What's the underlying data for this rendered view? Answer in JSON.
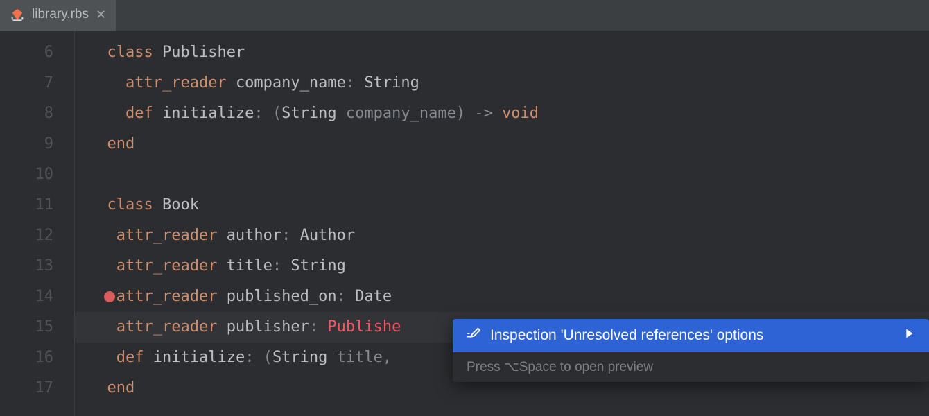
{
  "tab": {
    "filename": "library.rbs"
  },
  "gutter": {
    "start": 6,
    "end": 17
  },
  "code": {
    "lines": [
      {
        "indent": 1,
        "seg": [
          {
            "c": "kw",
            "t": "class "
          },
          {
            "c": "ident",
            "t": "Publisher"
          }
        ]
      },
      {
        "indent": 2,
        "seg": [
          {
            "c": "kw",
            "t": "attr_reader "
          },
          {
            "c": "ident",
            "t": "company_name"
          },
          {
            "c": "gray",
            "t": ": "
          },
          {
            "c": "type",
            "t": "String"
          }
        ]
      },
      {
        "indent": 2,
        "seg": [
          {
            "c": "kw",
            "t": "def "
          },
          {
            "c": "ident",
            "t": "initialize"
          },
          {
            "c": "gray",
            "t": ": ("
          },
          {
            "c": "type",
            "t": "String "
          },
          {
            "c": "gray",
            "t": "company_name) -> "
          },
          {
            "c": "kw",
            "t": "void"
          }
        ]
      },
      {
        "indent": 1,
        "seg": [
          {
            "c": "kw",
            "t": "end"
          }
        ]
      },
      {
        "indent": 0,
        "seg": []
      },
      {
        "indent": 1,
        "seg": [
          {
            "c": "kw",
            "t": "class "
          },
          {
            "c": "ident",
            "t": "Book"
          }
        ]
      },
      {
        "indent": 1,
        "seg": [
          {
            "c": "kw",
            "t": " attr_reader "
          },
          {
            "c": "ident",
            "t": "author"
          },
          {
            "c": "gray",
            "t": ": "
          },
          {
            "c": "type",
            "t": "Author"
          }
        ]
      },
      {
        "indent": 1,
        "seg": [
          {
            "c": "kw",
            "t": " attr_reader "
          },
          {
            "c": "ident",
            "t": "title"
          },
          {
            "c": "gray",
            "t": ": "
          },
          {
            "c": "type",
            "t": "String"
          }
        ]
      },
      {
        "indent": 1,
        "bulb": true,
        "seg": [
          {
            "c": "kw",
            "t": " attr_reader "
          },
          {
            "c": "ident",
            "t": "published_on"
          },
          {
            "c": "gray",
            "t": ": "
          },
          {
            "c": "type",
            "t": "Date"
          }
        ]
      },
      {
        "indent": 1,
        "hl": true,
        "seg": [
          {
            "c": "kw",
            "t": " attr_reader "
          },
          {
            "c": "ident",
            "t": "publisher"
          },
          {
            "c": "gray",
            "t": ": "
          },
          {
            "c": "err",
            "t": "Publishe"
          }
        ]
      },
      {
        "indent": 1,
        "seg": [
          {
            "c": "kw",
            "t": " def "
          },
          {
            "c": "ident",
            "t": "initialize"
          },
          {
            "c": "gray",
            "t": ": ("
          },
          {
            "c": "type",
            "t": "String "
          },
          {
            "c": "gray",
            "t": "title, "
          }
        ]
      },
      {
        "indent": 1,
        "seg": [
          {
            "c": "kw",
            "t": "end"
          }
        ]
      }
    ]
  },
  "popup": {
    "item": "Inspection 'Unresolved references' options",
    "footer": "Press ⌥Space to open preview"
  }
}
